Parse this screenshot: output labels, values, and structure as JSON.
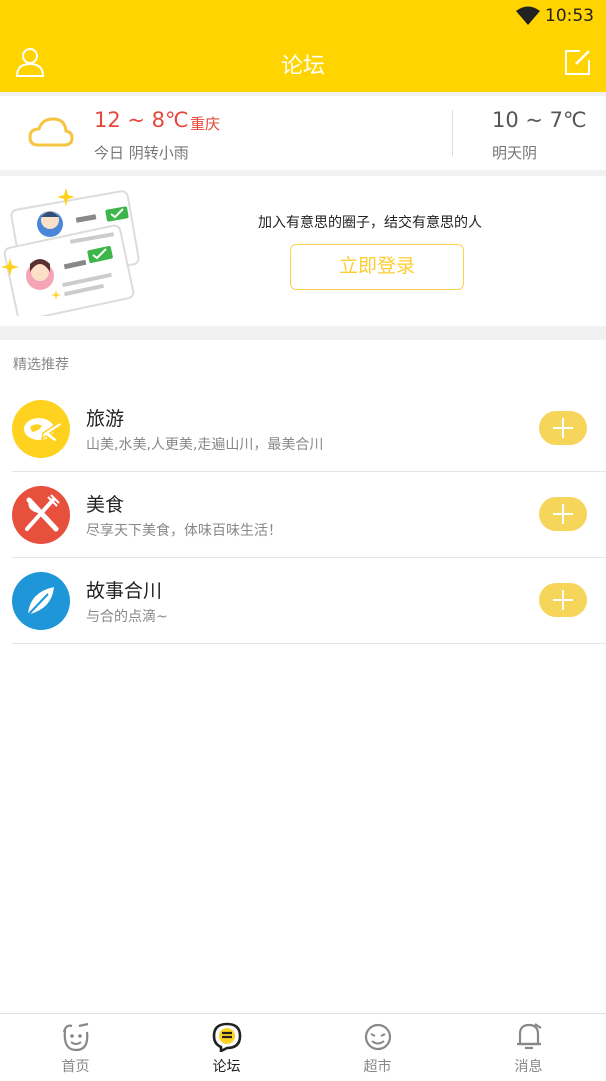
{
  "status_bar": {
    "time": "10:53"
  },
  "header": {
    "title": "论坛"
  },
  "weather": {
    "today_temp": "12 ~ 8℃",
    "city": "重庆",
    "today_desc": "今日 阴转小雨",
    "tomorrow_temp": "10 ~ 7℃",
    "tomorrow_desc": "明天阴"
  },
  "banner": {
    "slogan": "加入有意思的圈子，结交有意思的人",
    "login_label": "立即登录"
  },
  "section": {
    "label": "精选推荐"
  },
  "forums": [
    {
      "name": "旅游",
      "desc": "山美,水美,人更美,走遍山川，最美合川",
      "color": "#FFD21F",
      "icon": "plane-globe-icon"
    },
    {
      "name": "美食",
      "desc": "尽享天下美食，体味百味生活！",
      "color": "#E8503E",
      "icon": "fork-knife-icon"
    },
    {
      "name": "故事合川",
      "desc": "与合的点滴~",
      "color": "#1E96D8",
      "icon": "feather-icon"
    }
  ],
  "tabs": [
    {
      "label": "首页",
      "icon": "home-face-icon"
    },
    {
      "label": "论坛",
      "icon": "forum-chat-icon",
      "active": true
    },
    {
      "label": "超市",
      "icon": "smile-face-icon"
    },
    {
      "label": "消息",
      "icon": "bell-icon"
    }
  ]
}
